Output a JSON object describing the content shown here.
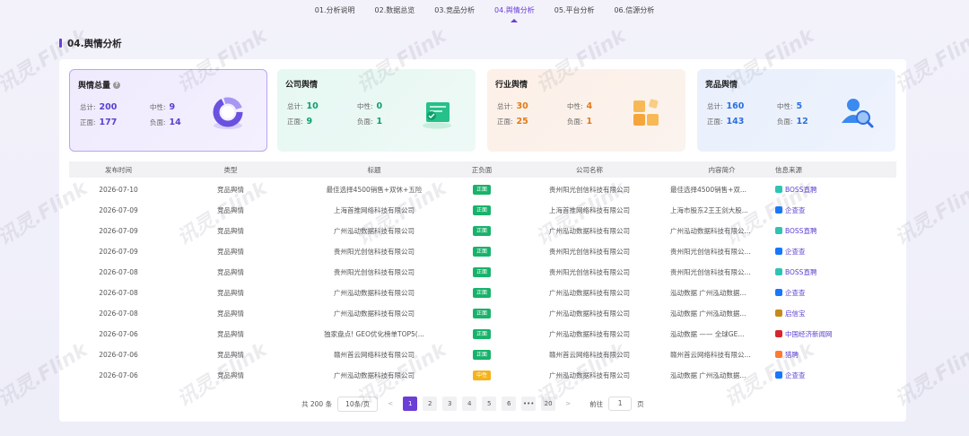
{
  "nav": {
    "tabs": [
      {
        "label": "01.分析说明",
        "active": false
      },
      {
        "label": "02.数据总览",
        "active": false
      },
      {
        "label": "03.竞品分析",
        "active": false
      },
      {
        "label": "04.舆情分析",
        "active": true
      },
      {
        "label": "05.平台分析",
        "active": false
      },
      {
        "label": "06.信源分析",
        "active": false
      }
    ]
  },
  "section": {
    "title": "04.舆情分析"
  },
  "cards": [
    {
      "title": "舆情总量",
      "total_label": "总计:",
      "total": "200",
      "neutral_label": "中性:",
      "neutral": "9",
      "positive_label": "正面:",
      "positive": "177",
      "negative_label": "负面:",
      "negative": "14",
      "icon": "donut-chart-icon"
    },
    {
      "title": "公司舆情",
      "total_label": "总计:",
      "total": "10",
      "neutral_label": "中性:",
      "neutral": "0",
      "positive_label": "正面:",
      "positive": "9",
      "negative_label": "负面:",
      "negative": "1",
      "icon": "certificate-icon"
    },
    {
      "title": "行业舆情",
      "total_label": "总计:",
      "total": "30",
      "neutral_label": "中性:",
      "neutral": "4",
      "positive_label": "正面:",
      "positive": "25",
      "negative_label": "负面:",
      "negative": "1",
      "icon": "blocks-icon"
    },
    {
      "title": "竞品舆情",
      "total_label": "总计:",
      "total": "160",
      "neutral_label": "中性:",
      "neutral": "5",
      "positive_label": "正面:",
      "positive": "143",
      "negative_label": "负面:",
      "negative": "12",
      "icon": "user-search-icon"
    }
  ],
  "table": {
    "headers": [
      "发布时间",
      "类型",
      "标题",
      "正负面",
      "公司名称",
      "内容简介",
      "信息来源"
    ],
    "rows": [
      {
        "date": "2026-07-10",
        "type": "竞品舆情",
        "title": "最佳选择4500销售+双休+五险",
        "sentiment": "正面",
        "company": "贵州阳光创信科技有限公司",
        "summary": "最佳选择4500销售+双...",
        "source": "BOSS直聘"
      },
      {
        "date": "2026-07-09",
        "type": "竞品舆情",
        "title": "上海首推网络科技有限公司",
        "sentiment": "正面",
        "company": "上海首推网络科技有限公司",
        "summary": "上海市股东2王王剑大股...",
        "source": "企查查"
      },
      {
        "date": "2026-07-09",
        "type": "竞品舆情",
        "title": "广州泓动数据科技有限公司",
        "sentiment": "正面",
        "company": "广州泓动数据科技有限公司",
        "summary": "广州泓动数据科技有限公...",
        "source": "BOSS直聘"
      },
      {
        "date": "2026-07-09",
        "type": "竞品舆情",
        "title": "贵州阳光创信科技有限公司",
        "sentiment": "正面",
        "company": "贵州阳光创信科技有限公司",
        "summary": "贵州阳光创信科技有限公...",
        "source": "企查查"
      },
      {
        "date": "2026-07-08",
        "type": "竞品舆情",
        "title": "贵州阳光创信科技有限公司",
        "sentiment": "正面",
        "company": "贵州阳光创信科技有限公司",
        "summary": "贵州阳光创信科技有限公...",
        "source": "BOSS直聘"
      },
      {
        "date": "2026-07-08",
        "type": "竞品舆情",
        "title": "广州泓动数据科技有限公司",
        "sentiment": "正面",
        "company": "广州泓动数据科技有限公司",
        "summary": "泓动数据 广州泓动数据...",
        "source": "企查查"
      },
      {
        "date": "2026-07-08",
        "type": "竞品舆情",
        "title": "广州泓动数据科技有限公司",
        "sentiment": "正面",
        "company": "广州泓动数据科技有限公司",
        "summary": "泓动数据 广州泓动数据...",
        "source": "启信宝"
      },
      {
        "date": "2026-07-06",
        "type": "竞品舆情",
        "title": "独家盘点! GEO优化榜单TOP5(...",
        "sentiment": "正面",
        "company": "广州泓动数据科技有限公司",
        "summary": "泓动数据 —— 全球GE...",
        "source": "中国经济新闻网"
      },
      {
        "date": "2026-07-06",
        "type": "竞品舆情",
        "title": "赣州首云网络科技有限公司",
        "sentiment": "正面",
        "company": "赣州首云网络科技有限公司",
        "summary": "赣州首云网络科技有限公...",
        "source": "猎聘"
      },
      {
        "date": "2026-07-06",
        "type": "竞品舆情",
        "title": "广州泓动数据科技有限公司",
        "sentiment": "中性",
        "company": "广州泓动数据科技有限公司",
        "summary": "泓动数据 广州泓动数据...",
        "source": "企查查"
      }
    ]
  },
  "pager": {
    "total": "共 200 条",
    "page_size": "10条/页",
    "prev": "<",
    "pages": [
      "1",
      "2",
      "3",
      "4",
      "5",
      "6",
      "•••",
      "20"
    ],
    "current": "1",
    "next": ">",
    "goto_label": "前往",
    "goto_value": "1",
    "goto_suffix": "页"
  },
  "watermark": "讯灵.Flink",
  "colors": {
    "accent": "#6b3fd6",
    "positive": "#19b26b",
    "neutral": "#f4b21b"
  }
}
